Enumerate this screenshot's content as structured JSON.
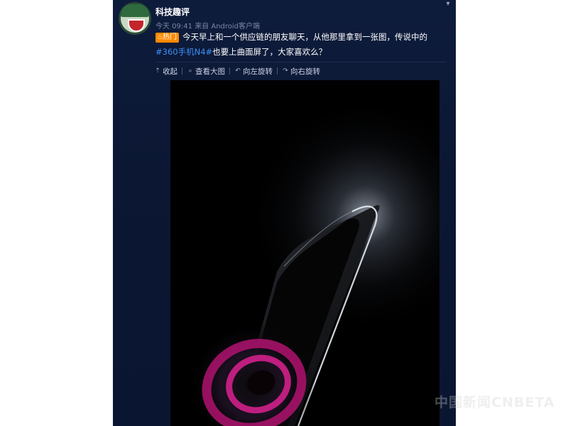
{
  "post": {
    "author": "科技趣评",
    "time": "今天 09:41",
    "source": "来自 Android客户端",
    "hot_label": "热门",
    "text_before": "今天早上和一个供应链的朋友聊天，从他那里拿到一张图，传说中的",
    "hashtag": "#360手机N4#",
    "text_after": "也要上曲面屏了，大家喜欢么？"
  },
  "toolbar": {
    "collect": "收起",
    "view_large": "查看大图",
    "rotate_left": "向左旋转",
    "rotate_right": "向右旋转"
  },
  "watermark": "中国新闻CNBETA",
  "icons": [
    "avatar",
    "chevron-down-icon",
    "flame-icon",
    "collapse-icon",
    "zoom-icon",
    "rotate-left-icon",
    "rotate-right-icon"
  ],
  "colors": {
    "panel_bg": "#0e1c3c",
    "hashtag": "#3c8ff5",
    "hot_badge": "#ff8a00",
    "text": "#ffffff"
  }
}
